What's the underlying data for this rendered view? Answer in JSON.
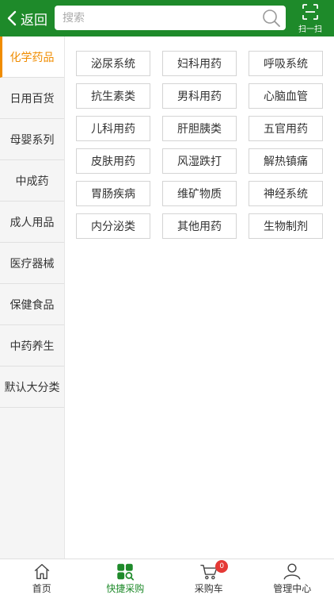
{
  "header": {
    "back_label": "返回",
    "search_placeholder": "搜索",
    "scan_label": "扫一扫"
  },
  "sidebar": {
    "items": [
      {
        "label": "化学药品",
        "active": true
      },
      {
        "label": "日用百货"
      },
      {
        "label": "母婴系列"
      },
      {
        "label": "中成药"
      },
      {
        "label": "成人用品"
      },
      {
        "label": "医疗器械"
      },
      {
        "label": "保健食品"
      },
      {
        "label": "中药养生"
      },
      {
        "label": "默认大分类"
      }
    ]
  },
  "categories": [
    "泌尿系统",
    "妇科用药",
    "呼吸系统",
    "抗生素类",
    "男科用药",
    "心脑血管",
    "儿科用药",
    "肝胆胰类",
    "五官用药",
    "皮肤用药",
    "风湿跌打",
    "解热镇痛",
    "胃肠疾病",
    "维矿物质",
    "神经系统",
    "内分泌类",
    "其他用药",
    "生物制剂"
  ],
  "tabbar": {
    "tabs": [
      {
        "label": "首页",
        "icon": "home-icon"
      },
      {
        "label": "快捷采购",
        "icon": "quick-purchase-icon",
        "active": true
      },
      {
        "label": "采购车",
        "icon": "cart-icon",
        "badge": "0"
      },
      {
        "label": "管理中心",
        "icon": "user-icon"
      }
    ]
  },
  "colors": {
    "brand_green": "#1e8a2a",
    "active_orange": "#f08c00",
    "badge_red": "#e53935"
  }
}
